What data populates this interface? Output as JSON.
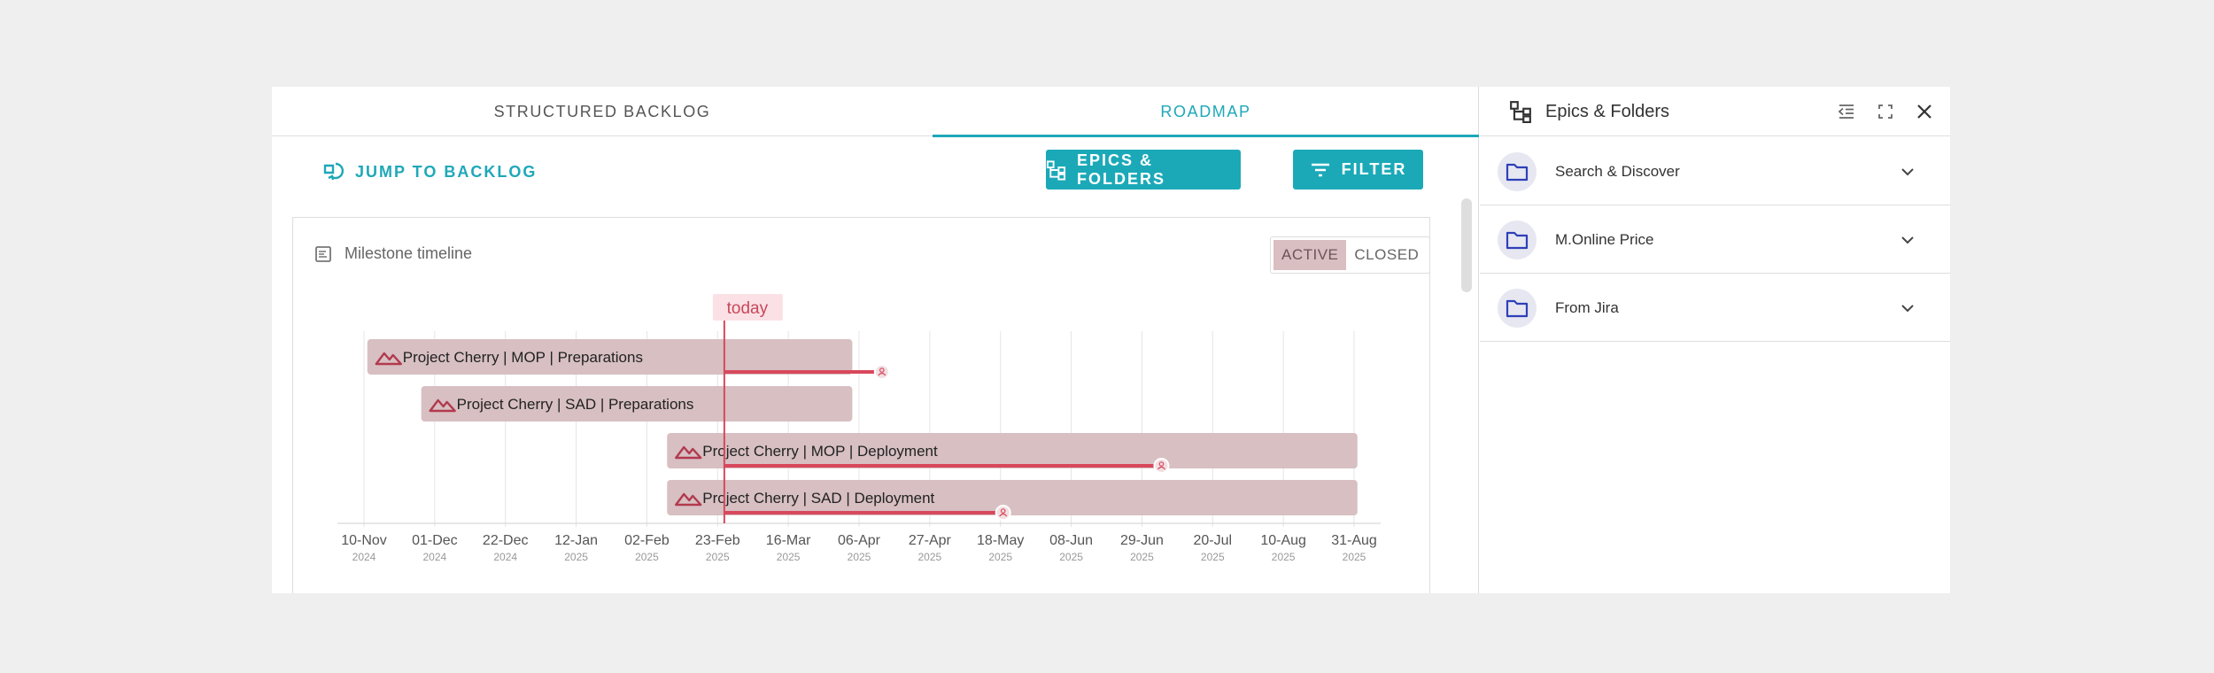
{
  "tabs": [
    {
      "label": "STRUCTURED BACKLOG"
    },
    {
      "label": "ROADMAP"
    }
  ],
  "toolbar": {
    "jump_label": "JUMP TO BACKLOG",
    "epics_label": "EPICS & FOLDERS",
    "filter_label": "FILTER"
  },
  "card": {
    "title": "Milestone timeline",
    "toggle_active": "ACTIVE",
    "toggle_closed": "CLOSED",
    "active_selected": true
  },
  "timeline": {
    "today_label": "today",
    "today_date": "2025-02-25",
    "ticks": [
      {
        "label": "10-Nov",
        "year": "2024",
        "date": "2024-11-10"
      },
      {
        "label": "01-Dec",
        "year": "2024",
        "date": "2024-12-01"
      },
      {
        "label": "22-Dec",
        "year": "2024",
        "date": "2024-12-22"
      },
      {
        "label": "12-Jan",
        "year": "2025",
        "date": "2025-01-12"
      },
      {
        "label": "02-Feb",
        "year": "2025",
        "date": "2025-02-02"
      },
      {
        "label": "23-Feb",
        "year": "2025",
        "date": "2025-02-23"
      },
      {
        "label": "16-Mar",
        "year": "2025",
        "date": "2025-03-16"
      },
      {
        "label": "06-Apr",
        "year": "2025",
        "date": "2025-04-06"
      },
      {
        "label": "27-Apr",
        "year": "2025",
        "date": "2025-04-27"
      },
      {
        "label": "18-May",
        "year": "2025",
        "date": "2025-05-18"
      },
      {
        "label": "08-Jun",
        "year": "2025",
        "date": "2025-06-08"
      },
      {
        "label": "29-Jun",
        "year": "2025",
        "date": "2025-06-29"
      },
      {
        "label": "20-Jul",
        "year": "2025",
        "date": "2025-07-20"
      },
      {
        "label": "10-Aug",
        "year": "2025",
        "date": "2025-08-10"
      },
      {
        "label": "31-Aug",
        "year": "2025",
        "date": "2025-08-31"
      }
    ],
    "milestones": [
      {
        "name": "Project Cherry | MOP | Preparations",
        "start": "2024-11-11",
        "end": "2025-04-04",
        "progress_end": "2025-04-12"
      },
      {
        "name": "Project Cherry | SAD | Preparations",
        "start": "2024-11-27",
        "end": "2025-04-04",
        "progress_end": null
      },
      {
        "name": "Project Cherry | MOP | Deployment",
        "start": "2025-02-08",
        "end": "2025-09-01",
        "progress_end": "2025-07-04"
      },
      {
        "name": "Project Cherry | SAD | Deployment",
        "start": "2025-02-08",
        "end": "2025-09-01",
        "progress_end": "2025-05-18"
      }
    ],
    "colors": {
      "bar": "#d7bfc2",
      "accent": "#d8485c",
      "today_bg": "#fbe1e6"
    }
  },
  "side": {
    "title": "Epics & Folders",
    "folders": [
      {
        "name": "Search & Discover"
      },
      {
        "name": "M.Online Price"
      },
      {
        "name": "From Jira"
      }
    ]
  },
  "colors": {
    "brand": "#1ba9b8",
    "folder_icon": "#2f3fb8"
  }
}
